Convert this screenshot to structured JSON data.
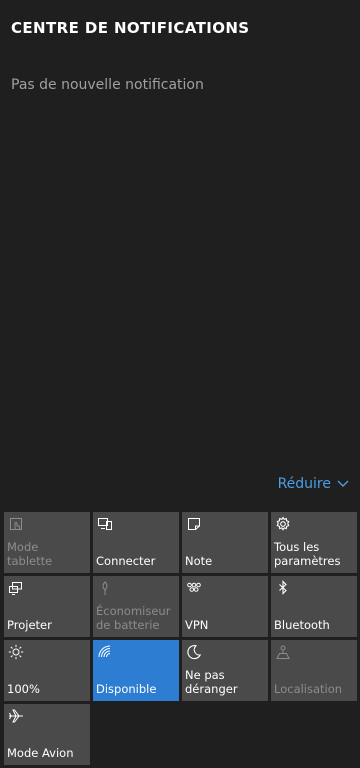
{
  "header": {
    "title": "CENTRE DE NOTIFICATIONS"
  },
  "notifications": {
    "empty_text": "Pas de nouvelle notification"
  },
  "collapse": {
    "label": "Réduire",
    "icon": "chevron-down-icon"
  },
  "colors": {
    "accent": "#2d7ed3",
    "link": "#4a9fe8",
    "tile": "#4a4a4a",
    "background": "#1f1f1f"
  },
  "quick_actions": [
    {
      "id": "tablet-mode",
      "label": "Mode tablette",
      "icon": "tablet-mode-icon",
      "state": "disabled"
    },
    {
      "id": "connect",
      "label": "Connecter",
      "icon": "connect-icon",
      "state": "off"
    },
    {
      "id": "note",
      "label": "Note",
      "icon": "note-icon",
      "state": "off"
    },
    {
      "id": "all-settings",
      "label": "Tous les\nparamètres",
      "icon": "gear-icon",
      "state": "off"
    },
    {
      "id": "project",
      "label": "Projeter",
      "icon": "project-icon",
      "state": "off"
    },
    {
      "id": "battery-saver",
      "label": "Économiseur\nde batterie",
      "icon": "battery-saver-icon",
      "state": "disabled"
    },
    {
      "id": "vpn",
      "label": "VPN",
      "icon": "vpn-icon",
      "state": "off"
    },
    {
      "id": "bluetooth",
      "label": "Bluetooth",
      "icon": "bluetooth-icon",
      "state": "off"
    },
    {
      "id": "brightness",
      "label": "100%",
      "icon": "brightness-icon",
      "state": "off"
    },
    {
      "id": "wifi",
      "label": "Disponible",
      "icon": "wifi-icon",
      "state": "on"
    },
    {
      "id": "quiet-hours",
      "label": "Ne pas\ndéranger",
      "icon": "moon-icon",
      "state": "off"
    },
    {
      "id": "location",
      "label": "Localisation",
      "icon": "location-icon",
      "state": "disabled"
    },
    {
      "id": "airplane-mode",
      "label": "Mode Avion",
      "icon": "airplane-icon",
      "state": "off"
    }
  ]
}
